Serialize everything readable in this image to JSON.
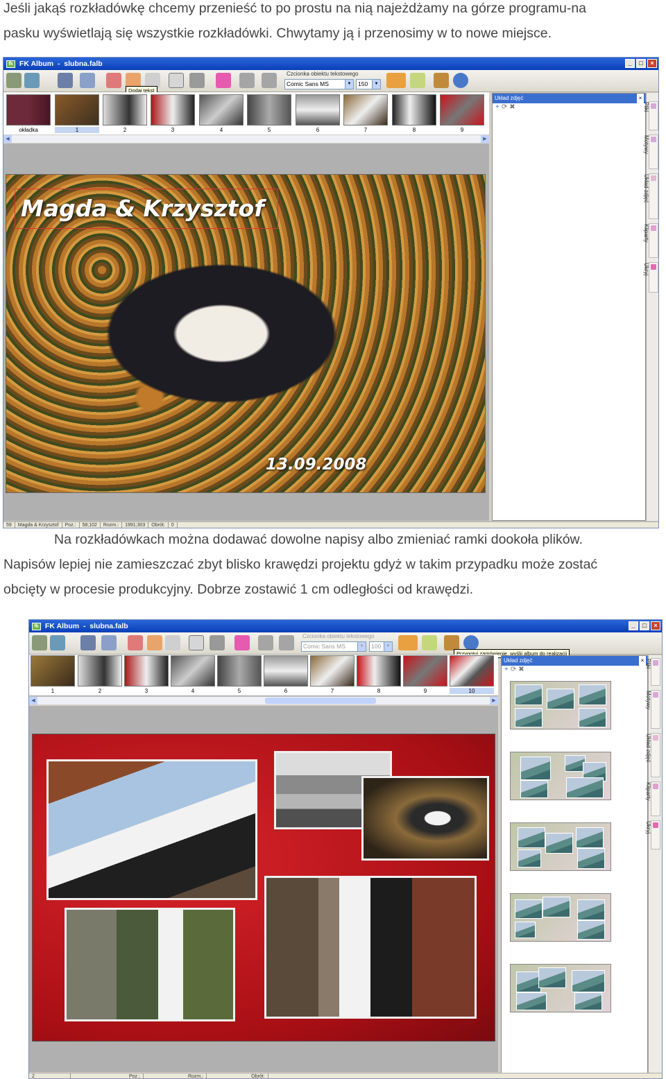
{
  "text": {
    "intro_line1": "Jeśli jakąś rozkładówkę chcemy przenieść to po prostu na nią najeżdżamy na górze programu-na",
    "intro_line2": "pasku wyświetlają się wszystkie rozkładówki. Chwytamy ją i przenosimy w to nowe miejsce.",
    "middle_line1": "Na rozkładówkach można dodawać dowolne napisy albo zmieniać ramki dookoła plików.",
    "middle_line2": "Napisów lepiej nie zamieszczać zbyt blisko krawędzi projektu gdyż w takim przypadku może zostać",
    "middle_line3": "obcięty w procesie produkcyjny. Dobrze zostawić 1 cm odległości od krawędzi."
  },
  "window1": {
    "app_name": "FK Album",
    "file_name": "slubna.falb",
    "font_label": "Czcionka obiektu tekstowego",
    "font_value": "Comic Sans MS",
    "size_value": "150",
    "tooltip": "Dodaj tekst",
    "thumb_labels": [
      "okładka",
      "1",
      "2",
      "3",
      "4",
      "5",
      "6",
      "7",
      "8",
      "9"
    ],
    "selected_thumb": "1",
    "photo_caption": "Magda & Krzysztof",
    "photo_date": "13.09.2008",
    "panel_title": "Układ zdjęć",
    "side_tabs": [
      "Pliki",
      "Motywy",
      "Układ zdjęć",
      "Kliparty",
      "Ukryj"
    ],
    "status": [
      "59",
      "Magda & Krzysztof",
      "Poz.:",
      "58;102",
      "Rozm.:",
      "1991;303",
      "Obrót:",
      "0"
    ]
  },
  "window2": {
    "app_name": "FK Album",
    "file_name": "slubna.falb",
    "font_label": "Czcionka obiektu tekstowego",
    "font_value": "Comic Sans MS",
    "size_value": "100",
    "tooltip": "Przygotuj zamówienie, wyślij album do realizacji",
    "thumb_labels": [
      "1",
      "2",
      "3",
      "4",
      "5",
      "6",
      "7",
      "8",
      "9",
      "10"
    ],
    "selected_thumb": "10",
    "panel_title": "Układ zdjęć",
    "side_tabs": [
      "Pliki",
      "Motywy",
      "Układ zdjęć",
      "Kliparty",
      "Ukryj"
    ],
    "status": [
      "2",
      "Poz.:",
      "Rozm.:",
      "Obrót:"
    ]
  },
  "colors": {
    "titlebar": "#0a3fb8",
    "spread_red": "#c8161d",
    "panel_header": "#3a6fd0"
  }
}
